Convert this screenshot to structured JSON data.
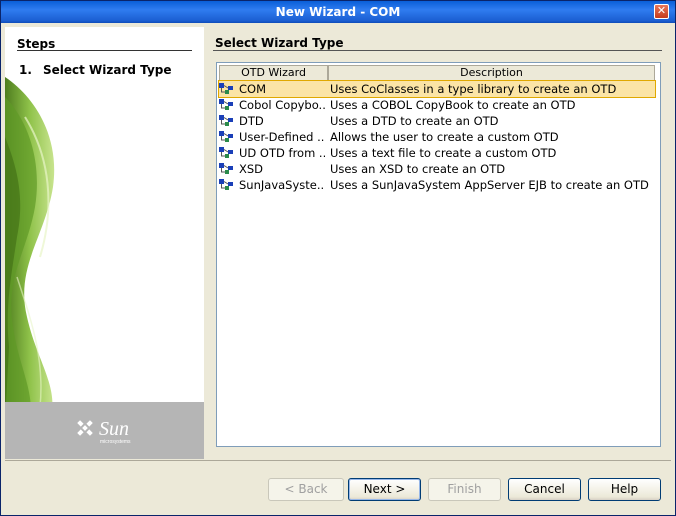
{
  "window": {
    "title": "New Wizard - COM",
    "close_glyph": "✕"
  },
  "steps": {
    "title": "Steps",
    "items": [
      {
        "num": "1.",
        "label": "Select Wizard Type"
      }
    ]
  },
  "brand": {
    "logo_text": "Sun",
    "logo_subtext": "microsystems"
  },
  "main": {
    "title": "Select Wizard Type",
    "table": {
      "columns": [
        "OTD Wizard",
        "Description"
      ],
      "rows": [
        {
          "name": "COM",
          "description": "Uses CoClasses in a type library to create an OTD",
          "selected": true
        },
        {
          "name": "Cobol Copybo...",
          "description": "Uses a COBOL CopyBook to create an OTD"
        },
        {
          "name": "DTD",
          "description": "Uses a DTD to create an OTD"
        },
        {
          "name": "User-Defined ...",
          "description": "Allows the user to create a custom OTD"
        },
        {
          "name": "UD OTD from ...",
          "description": "Uses a text file to create a custom OTD"
        },
        {
          "name": "XSD",
          "description": "Uses an XSD to create an OTD"
        },
        {
          "name": "SunJavaSyste...",
          "description": "Uses a SunJavaSystem AppServer EJB to create an OTD"
        }
      ]
    }
  },
  "buttons": {
    "back": "< Back",
    "next": "Next >",
    "finish": "Finish",
    "cancel": "Cancel",
    "help": "Help"
  },
  "colors": {
    "selection": "#fbe4a6",
    "titlebar": "#0a5fd8",
    "green_art": "#7cb342"
  }
}
